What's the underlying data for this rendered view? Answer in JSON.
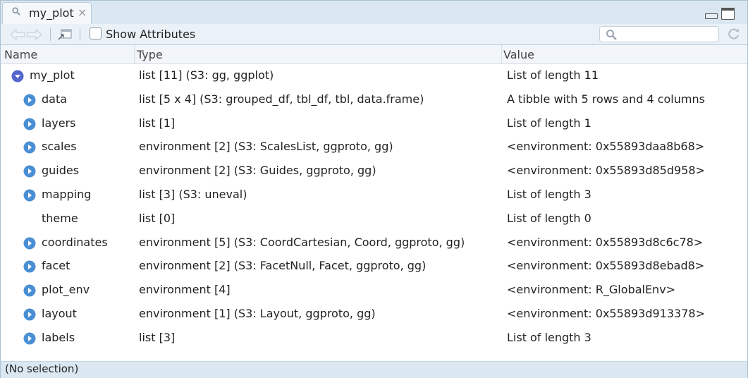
{
  "tab": {
    "title": "my_plot",
    "close": "×"
  },
  "toolbar": {
    "show_attributes_label": "Show Attributes",
    "search_placeholder": ""
  },
  "columns": {
    "name": "Name",
    "type": "Type",
    "value": "Value"
  },
  "rows": [
    {
      "name": "my_plot",
      "type": "list [11] (S3: gg, ggplot)",
      "value": "List of length 11",
      "level": 0,
      "toggle": "expanded"
    },
    {
      "name": "data",
      "type": "list [5 x 4] (S3: grouped_df, tbl_df, tbl, data.frame)",
      "value": "A tibble with 5 rows and 4 columns",
      "level": 1,
      "toggle": "collapsed"
    },
    {
      "name": "layers",
      "type": "list [1]",
      "value": "List of length 1",
      "level": 1,
      "toggle": "collapsed"
    },
    {
      "name": "scales",
      "type": "environment [2] (S3: ScalesList, ggproto, gg)",
      "value": "<environment: 0x55893daa8b68>",
      "level": 1,
      "toggle": "collapsed"
    },
    {
      "name": "guides",
      "type": "environment [2] (S3: Guides, ggproto, gg)",
      "value": "<environment: 0x55893d85d958>",
      "level": 1,
      "toggle": "collapsed"
    },
    {
      "name": "mapping",
      "type": "list [3] (S3: uneval)",
      "value": "List of length 3",
      "level": 1,
      "toggle": "collapsed"
    },
    {
      "name": "theme",
      "type": "list [0]",
      "value": "List of length 0",
      "level": 1,
      "toggle": "none"
    },
    {
      "name": "coordinates",
      "type": "environment [5] (S3: CoordCartesian, Coord, ggproto, gg)",
      "value": "<environment: 0x55893d8c6c78>",
      "level": 1,
      "toggle": "collapsed"
    },
    {
      "name": "facet",
      "type": "environment [2] (S3: FacetNull, Facet, ggproto, gg)",
      "value": "<environment: 0x55893d8ebad8>",
      "level": 1,
      "toggle": "collapsed"
    },
    {
      "name": "plot_env",
      "type": "environment [4]",
      "value": "<environment: R_GlobalEnv>",
      "level": 1,
      "toggle": "collapsed"
    },
    {
      "name": "layout",
      "type": "environment [1] (S3: Layout, ggproto, gg)",
      "value": "<environment: 0x55893d913378>",
      "level": 1,
      "toggle": "collapsed"
    },
    {
      "name": "labels",
      "type": "list [3]",
      "value": "List of length 3",
      "level": 1,
      "toggle": "collapsed"
    }
  ],
  "status": "(No selection)",
  "colors": {
    "toggle": "#4a8fd4",
    "toggle_expanded": "#5566cc",
    "header_bg": "#f2f6fa",
    "toolbar_bg": "#eaf1f7"
  }
}
